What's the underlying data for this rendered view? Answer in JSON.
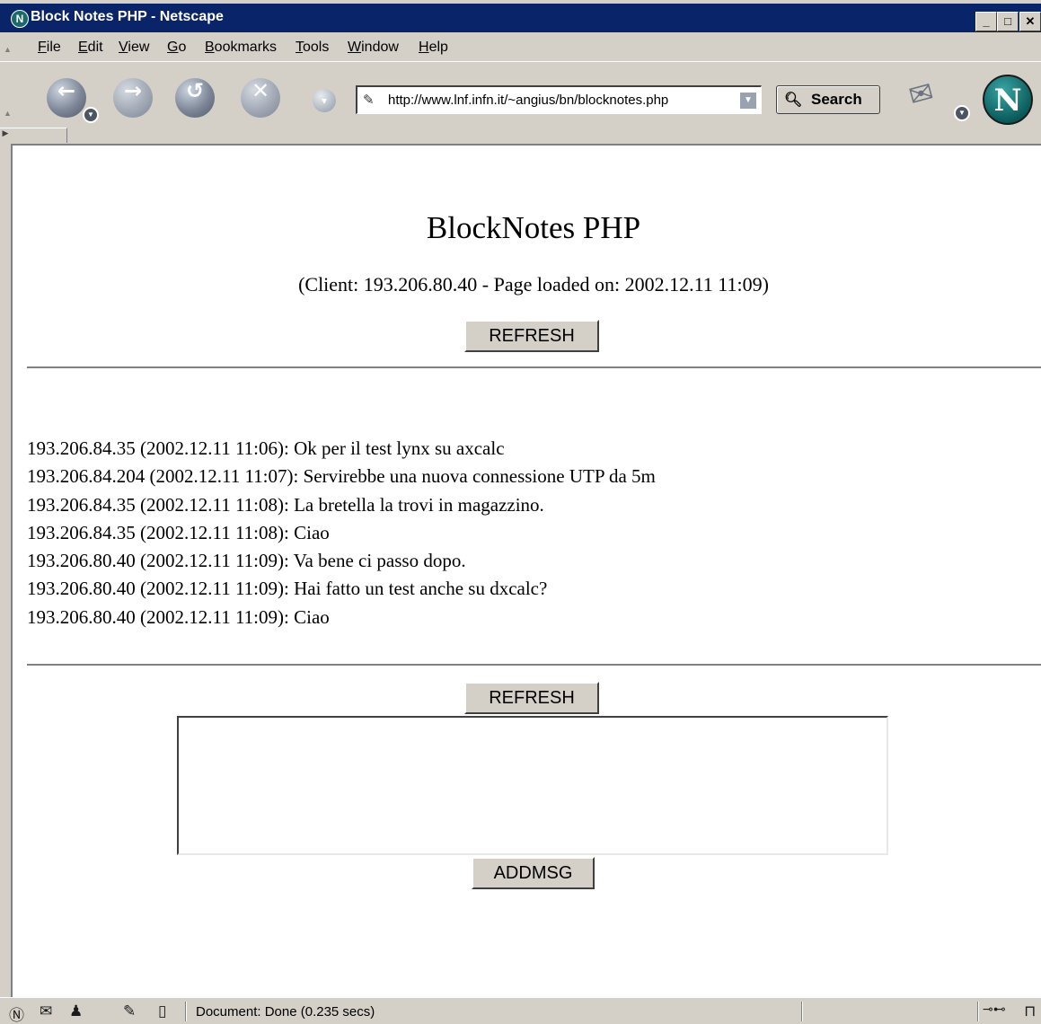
{
  "window": {
    "title": "Block Notes PHP - Netscape",
    "app_icon": "netscape-n-icon",
    "controls": {
      "minimize": "_",
      "maximize": "□",
      "close": "✕"
    }
  },
  "menu": {
    "items": [
      {
        "u": "F",
        "rest": "ile"
      },
      {
        "u": "E",
        "rest": "dit"
      },
      {
        "u": "V",
        "rest": "iew"
      },
      {
        "u": "G",
        "rest": "o"
      },
      {
        "u": "B",
        "rest": "ookmarks"
      },
      {
        "u": "T",
        "rest": "ools"
      },
      {
        "u": "W",
        "rest": "indow"
      },
      {
        "u": "H",
        "rest": "elp"
      }
    ]
  },
  "toolbar": {
    "icons": {
      "back": "back-arrow-icon",
      "forward": "forward-arrow-icon",
      "reload": "reload-icon",
      "stop": "stop-icon",
      "print": "print-icon",
      "logo": "netscape-logo-icon"
    },
    "url": "http://www.lnf.infn.it/~angius/bn/blocknotes.php",
    "search_label": "Search",
    "logo_letter": "N"
  },
  "page": {
    "title": "BlockNotes PHP",
    "subtitle": "(Client: 193.206.80.40 - Page loaded on: 2002.12.11 11:09)",
    "refresh_label": "REFRESH",
    "addmsg_label": "ADDMSG",
    "message_input_value": "",
    "messages": [
      "193.206.84.35 (2002.12.11 11:06): Ok per il test lynx su axcalc",
      "193.206.84.204 (2002.12.11 11:07): Servirebbe una nuova connessione UTP da 5m",
      "193.206.84.35 (2002.12.11 11:08): La bretella la trovi in magazzino.",
      "193.206.84.35 (2002.12.11 11:08): Ciao",
      "193.206.80.40 (2002.12.11 11:09): Va bene ci passo dopo.",
      "193.206.80.40 (2002.12.11 11:09): Hai fatto un test anche su dxcalc?",
      "193.206.80.40 (2002.12.11 11:09): Ciao"
    ]
  },
  "status": {
    "text": "Document: Done (0.235 secs)",
    "icons": [
      "navigator-icon",
      "mail-icon",
      "instant-messenger-icon",
      "composer-icon",
      "address-book-icon",
      "connection-icon",
      "security-lock-icon"
    ]
  }
}
